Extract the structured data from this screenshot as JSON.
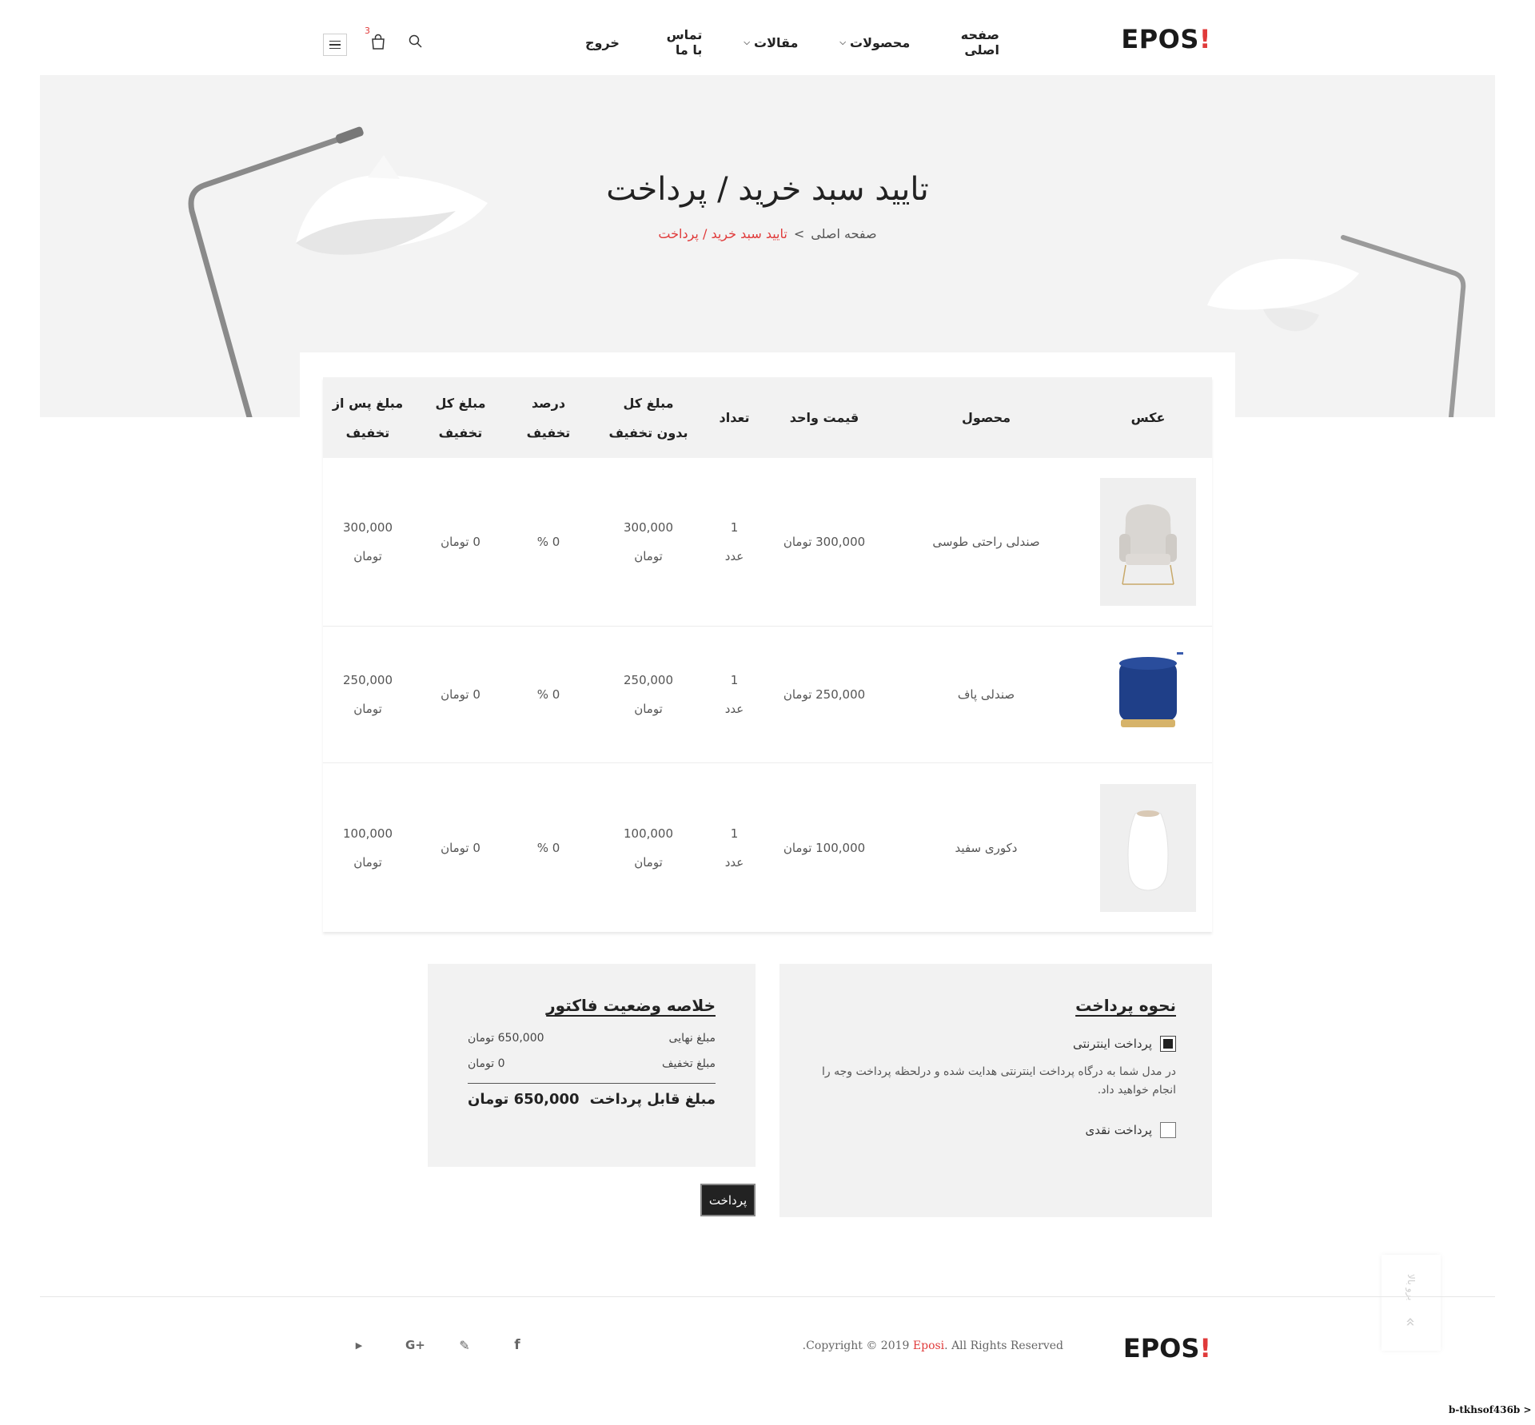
{
  "header": {
    "logo_text": "EPOS",
    "logo_mark": "!",
    "nav": [
      {
        "label": "صفحه اصلی",
        "has_dropdown": false
      },
      {
        "label": "محصولات",
        "has_dropdown": true
      },
      {
        "label": "مقالات",
        "has_dropdown": true
      },
      {
        "label": "تماس با ما",
        "has_dropdown": false
      },
      {
        "label": "خروج",
        "has_dropdown": false
      }
    ],
    "cart_count": "3",
    "icons": [
      "search-icon",
      "cart-icon",
      "menu-icon"
    ]
  },
  "hero": {
    "title": "تایید سبد خرید / پرداخت",
    "breadcrumb_home": "صفحه اصلی",
    "breadcrumb_sep": ">",
    "breadcrumb_current": "تایید سبد خرید / پرداخت"
  },
  "table": {
    "headers": [
      {
        "line1": "",
        "line2": "عکس"
      },
      {
        "line1": "",
        "line2": "محصول"
      },
      {
        "line1": "",
        "line2": "قیمت واحد"
      },
      {
        "line1": "",
        "line2": "تعداد"
      },
      {
        "line1": "مبلغ کل",
        "line2": "بدون تخفیف"
      },
      {
        "line1": "درصد",
        "line2": "تخفیف"
      },
      {
        "line1": "مبلغ کل",
        "line2": "تخفیف"
      },
      {
        "line1": "مبلغ پس از",
        "line2": "تخفیف"
      }
    ],
    "rows": [
      {
        "image": "armchair-photo",
        "product": "صندلی راحتی طوسی",
        "unit_price": "300,000 تومان",
        "qty": "1",
        "qty_unit": "عدد",
        "total": "300,000",
        "total_unit": "تومان",
        "discount_percent": "0 %",
        "discount_total": "0 تومان",
        "final": "300,000",
        "final_unit": "تومان"
      },
      {
        "image": "pouf-photo",
        "product": "صندلی پاف",
        "unit_price": "250,000 تومان",
        "qty": "1",
        "qty_unit": "عدد",
        "total": "250,000",
        "total_unit": "تومان",
        "discount_percent": "0 %",
        "discount_total": "0 تومان",
        "final": "250,000",
        "final_unit": "تومان"
      },
      {
        "image": "vase-photo",
        "product": "دکوری سفید",
        "unit_price": "100,000 تومان",
        "qty": "1",
        "qty_unit": "عدد",
        "total": "100,000",
        "total_unit": "تومان",
        "discount_percent": "0 %",
        "discount_total": "0 تومان",
        "final": "100,000",
        "final_unit": "تومان"
      }
    ]
  },
  "payment": {
    "title": "نحوه پرداخت",
    "online_label": "پرداخت اینترنتی",
    "online_selected": true,
    "online_desc": "در مدل شما به درگاه پرداخت اینترنتی هدایت شده و درلحظه پرداخت وجه را انجام خواهید داد.",
    "cash_label": "پرداخت نقدی",
    "cash_selected": false
  },
  "summary": {
    "title": "خلاصه وضعیت فاکتور",
    "final_label": "مبلغ نهایی",
    "final_value": "650,000 تومان",
    "discount_label": "مبلغ تخفیف",
    "discount_value": "0 تومان",
    "payable_label": "مبلغ قابل پرداخت",
    "payable_value": "650,000 تومان",
    "pay_button": "پرداخت"
  },
  "back_to_top": {
    "label": "برو بالا",
    "arrow": "«"
  },
  "footer": {
    "logo_text": "EPOS",
    "logo_mark": "!",
    "copyright_prefix": ".Copyright © 2019 ",
    "copyright_brand": "Eposi",
    "copyright_suffix": ". All Rights Reserved",
    "social": [
      "youtube-icon",
      "google-plus-icon",
      "twitter-icon",
      "facebook-icon"
    ]
  },
  "status_tag": "b-tkhsof436b >",
  "colors": {
    "accent": "#e03a3a",
    "panel": "#f2f2f2",
    "hero_bg": "#f3f3f3",
    "button": "#222222"
  }
}
